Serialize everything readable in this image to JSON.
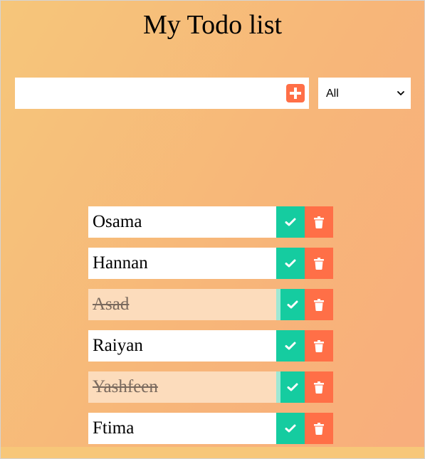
{
  "page_title": "My Todo list",
  "add_form": {
    "input_value": "",
    "input_placeholder": "",
    "add_icon": "plus-square-icon"
  },
  "filter": {
    "selected": "All",
    "options": [
      "All"
    ]
  },
  "todos": [
    {
      "text": "Osama",
      "completed": false
    },
    {
      "text": "Hannan",
      "completed": false
    },
    {
      "text": "Asad",
      "completed": true
    },
    {
      "text": "Raiyan",
      "completed": false
    },
    {
      "text": "Yashfeen",
      "completed": true
    },
    {
      "text": "Ftima",
      "completed": false
    }
  ],
  "icons": {
    "complete": "check-icon",
    "delete": "trash-icon"
  },
  "colors": {
    "complete_green": "#15cca0",
    "delete_orange": "#ff6f47",
    "completed_row_bg": "#fcdcbc",
    "gradient_start": "#f6c67a",
    "gradient_end": "#f8ad7c"
  }
}
